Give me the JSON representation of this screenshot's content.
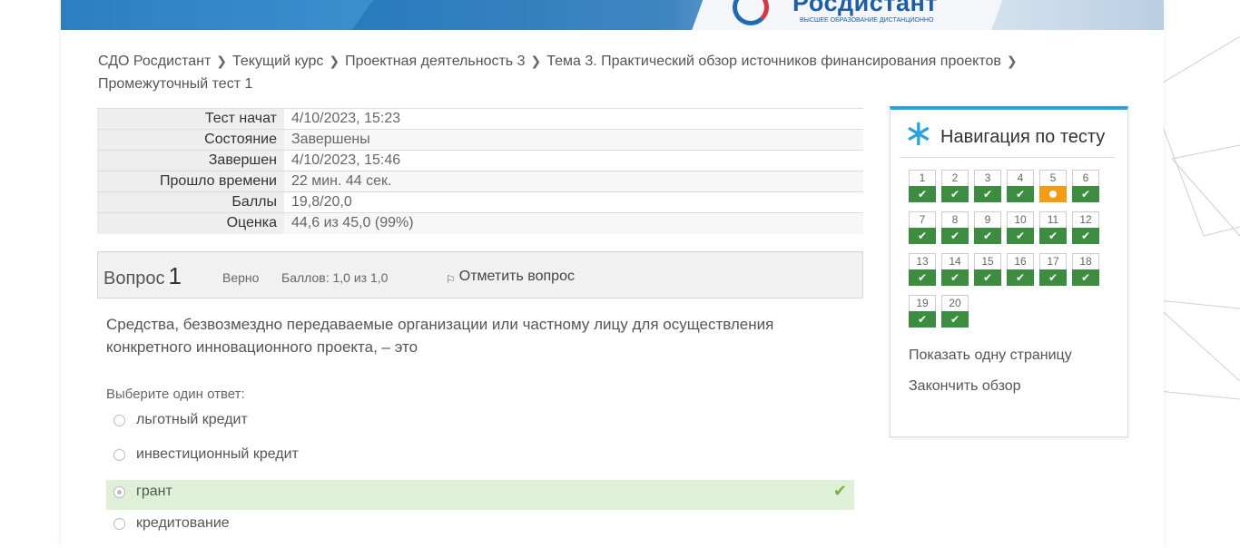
{
  "banner": {
    "logo_text": "Росдистант",
    "logo_sub": "ВЫСШЕЕ ОБРАЗОВАНИЕ ДИСТАНЦИОННО"
  },
  "breadcrumb": [
    "СДО Росдистант",
    "Текущий курс",
    "Проектная деятельность 3",
    "Тема 3. Практический обзор источников финансирования проектов",
    "Промежуточный тест 1"
  ],
  "summary": [
    {
      "label": "Тест начат",
      "value": "4/10/2023, 15:23"
    },
    {
      "label": "Состояние",
      "value": "Завершены"
    },
    {
      "label": "Завершен",
      "value": "4/10/2023, 15:46"
    },
    {
      "label": "Прошло времени",
      "value": "22 мин. 44 сек."
    },
    {
      "label": "Баллы",
      "value": "19,8/20,0"
    },
    {
      "label": "Оценка",
      "value": "44,6 из 45,0 (99%)"
    }
  ],
  "question": {
    "label": "Вопрос",
    "number": "1",
    "state": "Верно",
    "grade": "Баллов: 1,0 из 1,0",
    "flag_label": "Отметить вопрос",
    "text": "Средства, безвозмездно передаваемые организации или частному лицу для осуществления конкретного инновационного проекта, – это",
    "prompt": "Выберите один ответ:",
    "options": [
      {
        "text": "льготный кредит",
        "checked": false,
        "correct": false
      },
      {
        "text": "инвестиционный кредит",
        "checked": false,
        "correct": false
      },
      {
        "text": "грант",
        "checked": true,
        "correct": true
      },
      {
        "text": "кредитование",
        "checked": false,
        "correct": false
      }
    ]
  },
  "nav": {
    "title": "Навигация по тесту",
    "questions": [
      {
        "n": "1",
        "status": "correct"
      },
      {
        "n": "2",
        "status": "correct"
      },
      {
        "n": "3",
        "status": "correct"
      },
      {
        "n": "4",
        "status": "correct"
      },
      {
        "n": "5",
        "status": "partial"
      },
      {
        "n": "6",
        "status": "correct"
      },
      {
        "n": "7",
        "status": "correct"
      },
      {
        "n": "8",
        "status": "correct"
      },
      {
        "n": "9",
        "status": "correct"
      },
      {
        "n": "10",
        "status": "correct"
      },
      {
        "n": "11",
        "status": "correct"
      },
      {
        "n": "12",
        "status": "correct"
      },
      {
        "n": "13",
        "status": "correct"
      },
      {
        "n": "14",
        "status": "correct"
      },
      {
        "n": "15",
        "status": "correct"
      },
      {
        "n": "16",
        "status": "correct"
      },
      {
        "n": "17",
        "status": "correct"
      },
      {
        "n": "18",
        "status": "correct"
      },
      {
        "n": "19",
        "status": "correct"
      },
      {
        "n": "20",
        "status": "correct"
      }
    ],
    "show_one_page": "Показать одну страницу",
    "finish_review": "Закончить обзор"
  },
  "colors": {
    "accent": "#29a3e0",
    "correct": "#3c8d3f",
    "partial": "#f39c12",
    "correct_bg": "#dff0d8"
  }
}
